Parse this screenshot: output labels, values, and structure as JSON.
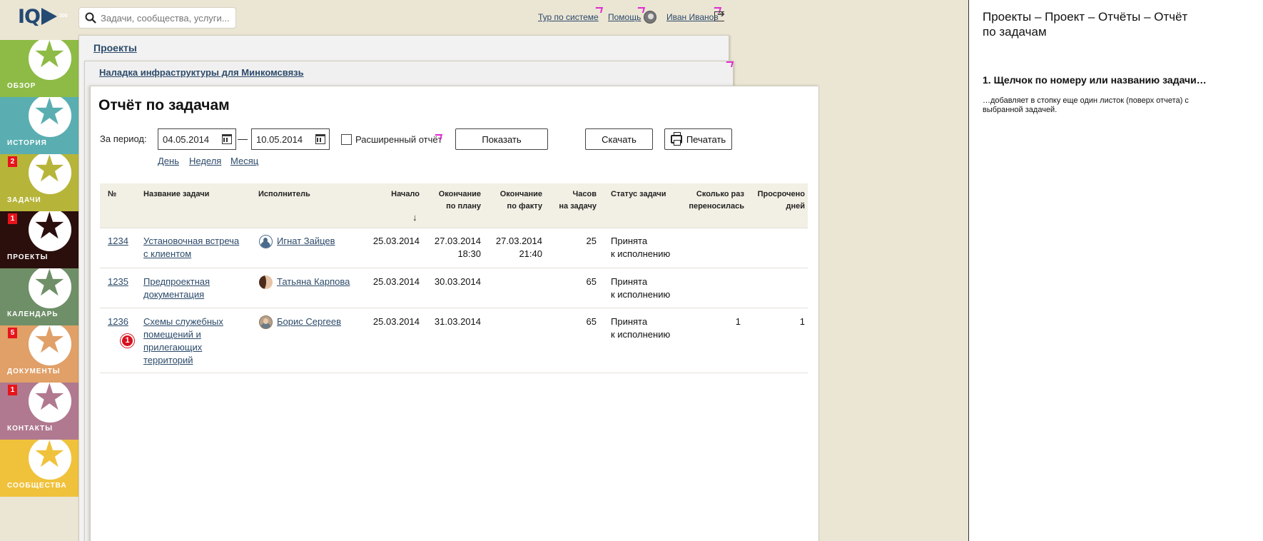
{
  "header": {
    "logo_text": "IQ",
    "logo_num": "300",
    "search_placeholder": "Задачи, сообщества, услуги...",
    "tour_label": "Тур по системе",
    "help_label": "Помощь",
    "user_name": "Иван Иванов"
  },
  "sidebar": {
    "items": [
      {
        "label": "ОБЗОР",
        "color": "#8dbb45",
        "star": "#8dbb45",
        "badge": ""
      },
      {
        "label": "ИСТОРИЯ",
        "color": "#5aaeb1",
        "star": "#5aaeb1",
        "badge": ""
      },
      {
        "label": "ЗАДАЧИ",
        "color": "#b6b53a",
        "star": "#b6b53a",
        "badge": "2"
      },
      {
        "label": "ПРОЕКТЫ",
        "color": "#2a0f0c",
        "star": "#2a0f0c",
        "badge": "1"
      },
      {
        "label": "КАЛЕНДАРЬ",
        "color": "#6f8f68",
        "star": "#6f8f68",
        "badge": ""
      },
      {
        "label": "ДОКУМЕНТЫ",
        "color": "#e0a068",
        "star": "#e0a068",
        "badge": "5"
      },
      {
        "label": "КОНТАКТЫ",
        "color": "#b0798f",
        "star": "#b0798f",
        "badge": "1"
      },
      {
        "label": "СООБЩЕСТВА",
        "color": "#f0c23c",
        "star": "#f0c23c",
        "badge": ""
      }
    ]
  },
  "breadcrumbs": {
    "projects": "Проекты",
    "project": "Наладка инфраструктуры для Минкомсвязь"
  },
  "report": {
    "title": "Отчёт по задачам",
    "period_label": "За период:",
    "date_from": "04.05.2014",
    "date_to": "10.05.2014",
    "dash": "—",
    "extended_label": "Расширенный отчёт",
    "show_button": "Показать",
    "download_button": "Скачать",
    "print_button": "Печатать",
    "quick_day": "День",
    "quick_week": "Неделя",
    "quick_month": "Месяц",
    "sort_arrow": "↓"
  },
  "table": {
    "headers": {
      "num": "№",
      "name": "Название задачи",
      "assignee": "Исполнитель",
      "start": "Начало",
      "plan_end_1": "Окончание",
      "plan_end_2": "по плану",
      "fact_end_1": "Окончание",
      "fact_end_2": "по факту",
      "hours_1": "Часов",
      "hours_2": "на задачу",
      "status": "Статус задачи",
      "moved_1": "Сколько раз",
      "moved_2": "переносилась",
      "overdue_1": "Просрочено",
      "overdue_2": "дней"
    },
    "rows": [
      {
        "num": "1234",
        "name_1": "Установочная встреча",
        "name_2": "с клиентом",
        "name_3": "",
        "name_4": "",
        "assignee": "Игнат Зайцев",
        "start": "25.03.2014",
        "plan_date": "27.03.2014",
        "plan_time": "18:30",
        "fact_date": "27.03.2014",
        "fact_time": "21:40",
        "hours": "25",
        "status_1": "Принята",
        "status_2": "к исполнению",
        "moved": "",
        "overdue": ""
      },
      {
        "num": "1235",
        "name_1": "Предпроектная",
        "name_2": "документация",
        "name_3": "",
        "name_4": "",
        "assignee": "Татьяна Карпова",
        "start": "25.03.2014",
        "plan_date": "30.03.2014",
        "plan_time": "",
        "fact_date": "",
        "fact_time": "",
        "hours": "65",
        "status_1": "Принята",
        "status_2": "к исполнению",
        "moved": "",
        "overdue": ""
      },
      {
        "num": "1236",
        "name_1": "Схемы служебных",
        "name_2": "помещений и",
        "name_3": "прилегающих",
        "name_4": "территорий",
        "assignee": "Борис Сергеев",
        "start": "25.03.2014",
        "plan_date": "31.03.2014",
        "plan_time": "",
        "fact_date": "",
        "fact_time": "",
        "hours": "65",
        "status_1": "Принята",
        "status_2": "к исполнению",
        "moved": "1",
        "overdue": "1"
      }
    ],
    "marker_badge": "1"
  },
  "panel": {
    "title": "Проекты – Проект – Отчёты – Отчёт по задачам",
    "heading": "1. Щелчок по номеру или названию задачи…",
    "note": "…добавляет в стопку еще один листок (поверх отчета) с выбранной задачей."
  },
  "colors": {
    "background": "#ebe5d4",
    "link": "#2c4a6a",
    "pin": "#e02ad0",
    "badge": "#e8141b"
  }
}
